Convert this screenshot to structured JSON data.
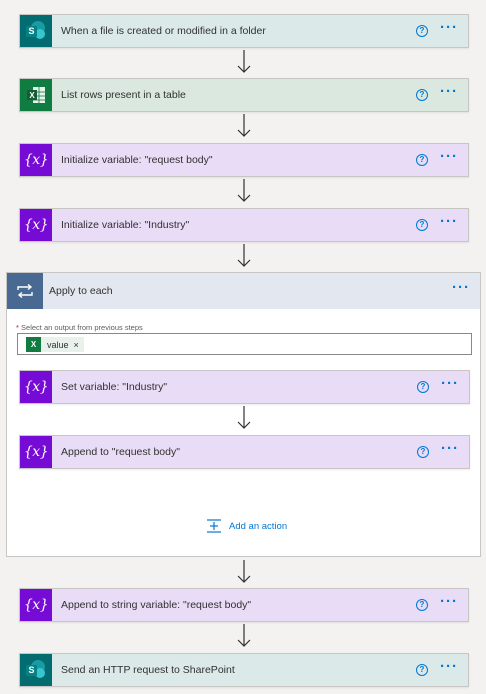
{
  "steps": {
    "trigger": {
      "title": "When a file is created or modified in a folder",
      "icon": "sharepoint-icon",
      "tile_letter": "S"
    },
    "list_rows": {
      "title": "List rows present in a table",
      "icon": "excel-icon",
      "tile_letter": "X"
    },
    "init_request_body": {
      "title": "Initialize variable: \"request body\"",
      "icon": "variable-icon"
    },
    "init_industry": {
      "title": "Initialize variable: \"Industry\"",
      "icon": "variable-icon"
    },
    "append_string": {
      "title": "Append to string variable: \"request body\"",
      "icon": "variable-icon"
    },
    "send_http": {
      "title": "Send an HTTP request to SharePoint",
      "icon": "sharepoint-icon",
      "tile_letter": "S"
    }
  },
  "apply_to_each": {
    "title": "Apply to each",
    "icon": "loop-icon",
    "field_required_mark": "*",
    "field_label": "Select an output from previous steps",
    "token": {
      "label": "value",
      "close": "×",
      "icon": "excel-icon",
      "icon_letter": "X"
    },
    "inner_steps": {
      "set_industry": {
        "title": "Set variable: \"Industry\"",
        "icon": "variable-icon"
      },
      "append_request_body": {
        "title": "Append to \"request body\"",
        "icon": "variable-icon"
      }
    },
    "add_action_label": "Add an action"
  },
  "common": {
    "help_glyph": "?",
    "more_glyph": "···",
    "variable_glyph": "{x}"
  },
  "colors": {
    "sharepoint": "#036c70",
    "excel": "#107c41",
    "variable": "#770bd6",
    "loop": "#486991",
    "accent": "#0078d4"
  }
}
